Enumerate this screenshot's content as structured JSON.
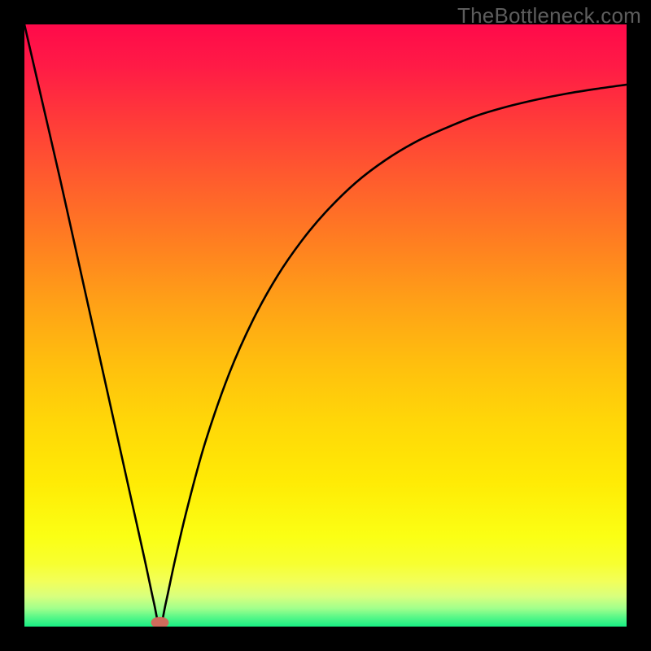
{
  "watermark": "TheBottleneck.com",
  "chart_data": {
    "type": "line",
    "title": "",
    "xlabel": "",
    "ylabel": "",
    "xlim": [
      0,
      1
    ],
    "ylim": [
      0,
      1
    ],
    "grid": false,
    "legend": false,
    "marker": {
      "x": 0.225,
      "y": 0.0
    },
    "series": [
      {
        "name": "curve",
        "color": "#000000",
        "x": [
          0.0,
          0.03,
          0.06,
          0.09,
          0.12,
          0.15,
          0.18,
          0.2,
          0.215,
          0.225,
          0.235,
          0.25,
          0.27,
          0.3,
          0.34,
          0.38,
          0.42,
          0.46,
          0.5,
          0.55,
          0.6,
          0.65,
          0.7,
          0.75,
          0.8,
          0.85,
          0.9,
          0.95,
          1.0
        ],
        "y": [
          1.0,
          0.87,
          0.74,
          0.605,
          0.47,
          0.335,
          0.2,
          0.11,
          0.04,
          0.0,
          0.04,
          0.11,
          0.195,
          0.305,
          0.42,
          0.51,
          0.582,
          0.64,
          0.688,
          0.737,
          0.775,
          0.805,
          0.828,
          0.848,
          0.863,
          0.875,
          0.885,
          0.893,
          0.9
        ]
      }
    ],
    "gradient_stops": [
      {
        "pos": 0.0,
        "color": "#ff0a4a"
      },
      {
        "pos": 0.07,
        "color": "#ff1b46"
      },
      {
        "pos": 0.16,
        "color": "#ff3b39"
      },
      {
        "pos": 0.26,
        "color": "#ff5d2d"
      },
      {
        "pos": 0.36,
        "color": "#ff7e21"
      },
      {
        "pos": 0.46,
        "color": "#ffa017"
      },
      {
        "pos": 0.56,
        "color": "#ffbe0e"
      },
      {
        "pos": 0.66,
        "color": "#ffd708"
      },
      {
        "pos": 0.76,
        "color": "#ffeb05"
      },
      {
        "pos": 0.85,
        "color": "#fbff14"
      },
      {
        "pos": 0.895,
        "color": "#f7ff30"
      },
      {
        "pos": 0.925,
        "color": "#f2ff5a"
      },
      {
        "pos": 0.95,
        "color": "#d8ff7e"
      },
      {
        "pos": 0.97,
        "color": "#a0ff8c"
      },
      {
        "pos": 0.985,
        "color": "#55f788"
      },
      {
        "pos": 1.0,
        "color": "#18ee84"
      }
    ],
    "marker_color": "#cf6b5c"
  }
}
